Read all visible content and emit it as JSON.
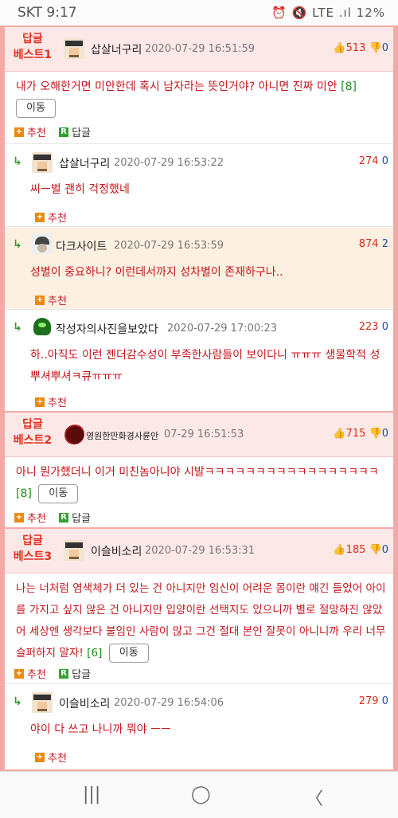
{
  "status": {
    "time": "SKT 9:17",
    "right": "⏰ 🔇 LTE .ıl 12%"
  },
  "threads": [
    {
      "best_label": "답글\n베스트1",
      "nick": "삽살너구리",
      "date": "2020-07-29 16:51:59",
      "up": "513",
      "down": "0",
      "text": "내가 오해한거면 미안한데 혹시 남자라는 뜻인거야? 아니면 진짜 미안",
      "reply_count": "[8]",
      "move_label": "이동",
      "recommend_label": "추천",
      "reply_label": "답글"
    },
    {
      "best_label": "답글\n베스트2",
      "nick": "영원한만화경사륜안",
      "date": "07-29 16:51:53",
      "up": "715",
      "down": "0",
      "text": "아니 뭔가했더니 이거 미친놈아니야 시발ㅋㅋㅋㅋㅋㅋㅋㅋㅋㅋㅋㅋㅋㅋㅋㅋㅋ",
      "reply_count": "[8]",
      "move_label": "이동",
      "recommend_label": "추천",
      "reply_label": "답글"
    },
    {
      "best_label": "답글\n베스트3",
      "nick": "이슬비소리",
      "date": "2020-07-29 16:53:31",
      "up": "185",
      "down": "0",
      "text": "나는 너처럼 염색체가 더 있는 건 아니지만 임신이 어려운 몸이란 얘긴 들었어 아이를 가지고 싶지 않은 건 아니지만 입양이란 선택지도 있으니까 별로 절망하진 않았어 세상엔 생각보다 불임인 사람이 많고 그건 절대 본인 잘못이 아니니까 우리 너무 슬퍼하지 말자!",
      "reply_count": "[6]",
      "move_label": "이동",
      "recommend_label": "추천",
      "reply_label": "답글"
    }
  ],
  "replies": [
    {
      "nick": "삽살너구리",
      "date": "2020-07-29 16:53:22",
      "up": "274",
      "down": "0",
      "text": "씨ㅡ벌 괜히 걱정했네",
      "recommend_label": "추천"
    },
    {
      "nick": "다크사이트",
      "date": "2020-07-29 16:53:59",
      "up": "874",
      "down": "2",
      "text": "성별이 중요하니? 이런데서까지 성차별이 존재하구나..",
      "recommend_label": "추천"
    },
    {
      "nick": "작성자의사진을보았다",
      "date": "2020-07-29 17:00:23",
      "up": "223",
      "down": "0",
      "text": "하..아직도 이런 젠더감수성이 부족한사람들이 보이다니 ㅠㅠㅠ 생물학적 성뿌셔뿌셔ㅋ큐ㅠㅠㅠ",
      "recommend_label": "추천"
    },
    {
      "nick": "이슬비소리",
      "date": "2020-07-29 16:54:06",
      "up": "279",
      "down": "0",
      "text": "야이 다 쓰고 나니까 뭐야 ㅡㅡ",
      "recommend_label": "추천"
    }
  ],
  "navbar": {
    "recent": "|||",
    "home": "◯",
    "back": "〈"
  }
}
